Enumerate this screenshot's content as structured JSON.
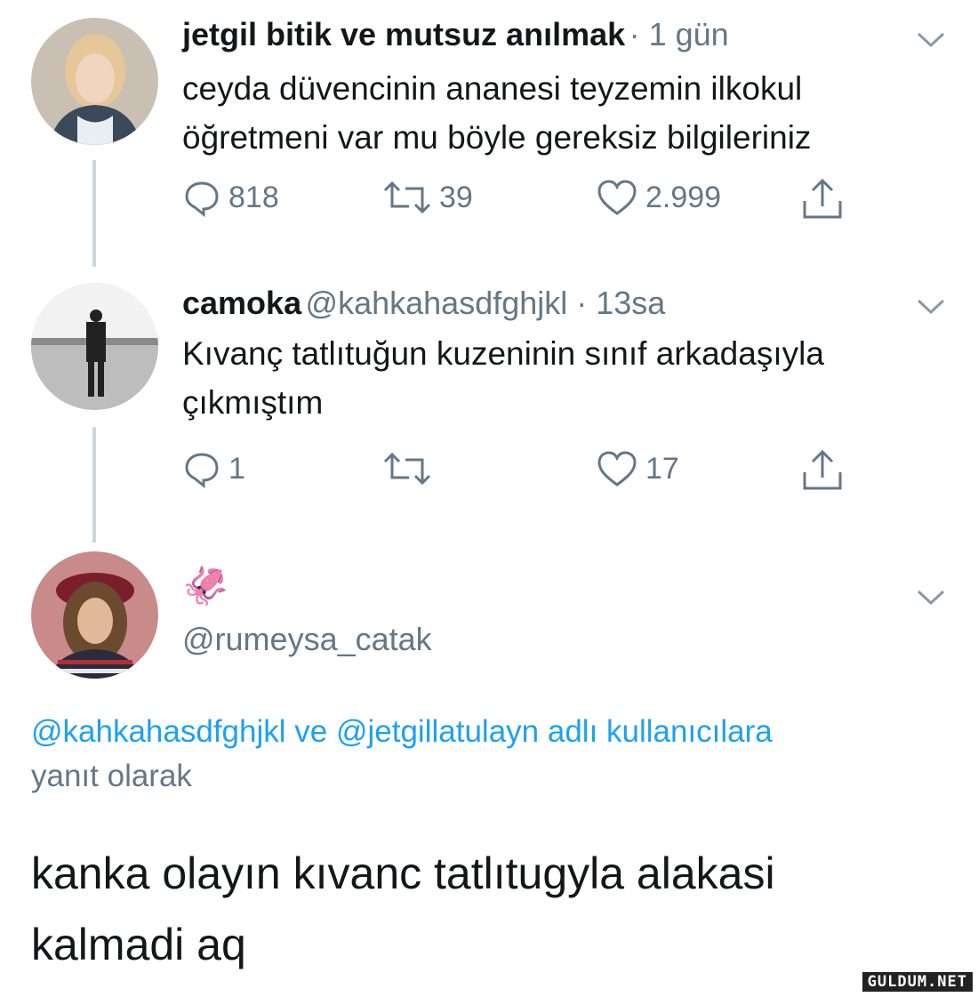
{
  "tweets": [
    {
      "name": "jetgil bitik ve mutsuz anılmak",
      "meta": "· 1 gün",
      "text_lines": [
        "ceyda düvencinin ananesi teyzemin ilkokul",
        "öğretmeni var mu böyle gereksiz bilgileriniz"
      ],
      "replies": "818",
      "retweets": "39",
      "likes": "2.999"
    },
    {
      "name": "camoka",
      "meta": "@kahkahasdfghjkl · 13sa",
      "text_lines": [
        "Kıvanç tatlıtuğun kuzeninin sınıf arkadaşıyla",
        "çıkmıştım"
      ],
      "replies": "1",
      "retweets": "",
      "likes": "17"
    }
  ],
  "main_tweet": {
    "name_emoji": "🦑",
    "handle": "@rumeysa_catak",
    "reply_to": {
      "mention1": "@kahkahasdfghjkl",
      "conj": "ve",
      "mention2": "@jetgillatulayn",
      "suffix": "adlı kullanıcılara",
      "line2": "yanıt olarak"
    },
    "text_lines": [
      "kanka olayın kıvanc tatlıtugyla alakasi",
      "kalmadi aq"
    ]
  },
  "watermark": "GULDUM.NET",
  "colors": {
    "link": "#1da1f2",
    "muted": "#657786",
    "line": "#ccd6dd"
  },
  "icons": [
    "reply-icon",
    "retweet-icon",
    "like-icon",
    "share-icon",
    "chevron-down-icon"
  ]
}
